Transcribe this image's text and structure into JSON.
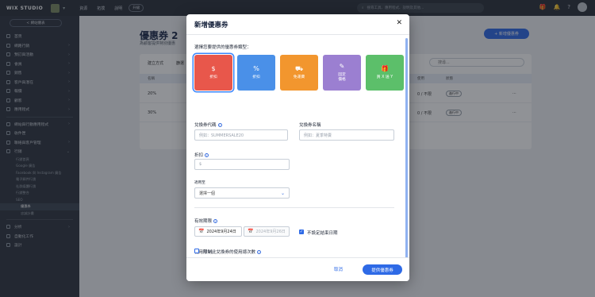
{
  "topbar": {
    "brand": "WIX STUDIO",
    "nav": [
      "資源",
      "拓撲",
      "說明"
    ],
    "pill": "升級",
    "search_placeholder": "搜尋工具、應用程式、說明及其他..."
  },
  "sidebar": {
    "back": "< 網站儀表",
    "items": [
      {
        "label": "首頁",
        "arrow": ""
      },
      {
        "label": "網路行銷",
        "arrow": "›"
      },
      {
        "label": "預訂與活動",
        "arrow": "›"
      },
      {
        "label": "會員",
        "arrow": "›"
      },
      {
        "label": "銷售",
        "arrow": "›"
      },
      {
        "label": "客戶與潛在",
        "arrow": "›"
      },
      {
        "label": "報價",
        "arrow": "›"
      },
      {
        "label": "顧客",
        "arrow": "›"
      },
      {
        "label": "應用程式",
        "arrow": "›"
      }
    ],
    "items2": [
      {
        "label": "網站與行動應用程式",
        "arrow": "›"
      },
      {
        "label": "收件匣",
        "arrow": ""
      },
      {
        "label": "聯絡與客戶管理",
        "arrow": "›"
      },
      {
        "label": "行銷",
        "arrow": "⌄"
      }
    ],
    "subs": [
      "行銷首頁",
      "Google 廣告",
      "Facebook 與 Instagram 廣告",
      "電子郵件行銷",
      "社群媒體行銷",
      "行銷整合",
      "SEO"
    ],
    "subs_l2": [
      "優惠券",
      "忠誠計畫"
    ],
    "items3": [
      {
        "label": "分析",
        "arrow": "›"
      },
      {
        "label": "自動化工作",
        "arrow": ""
      },
      {
        "label": "設計",
        "arrow": ""
      }
    ]
  },
  "main": {
    "title": "優惠券 2",
    "subtitle": "為顧客提供特別優惠",
    "new_coupon": "+ 新增優惠券",
    "filter_a": "建立方式",
    "filter_b": "篩選",
    "search": "搜尋...",
    "cols": [
      "名稱",
      "使用",
      "狀態"
    ],
    "rows": [
      {
        "name": "20%",
        "uses": "0 / 不限",
        "status": "進行中"
      },
      {
        "name": "30%",
        "uses": "0 / 不限",
        "status": "進行中"
      }
    ]
  },
  "modal": {
    "title": "新增優惠券",
    "type_prompt": "選擇您要提供的優惠券類型：",
    "types": [
      {
        "icon": "$",
        "label": "折扣",
        "color": "#e8574b",
        "selected": true
      },
      {
        "icon": "%",
        "label": "折扣",
        "color": "#4a90e8",
        "selected": false
      },
      {
        "icon": "⛟",
        "label": "免運費",
        "color": "#f2962e",
        "selected": false
      },
      {
        "icon": "✎",
        "label": "固定\n價格",
        "color": "#9b7fd1",
        "selected": false
      },
      {
        "icon": "🎁",
        "label": "買 X 送 Y",
        "color": "#5cbf6a",
        "selected": false
      }
    ],
    "code_label": "兌換券代碼",
    "code_placeholder": "例如：SUMMERSALE20",
    "name_label": "兌換券名稱",
    "name_placeholder": "例如：夏季特賣",
    "discount_label": "折扣",
    "discount_placeholder": "$",
    "apply_label": "適用至",
    "apply_value": "選擇一個",
    "validity_label": "有效期限",
    "start_date": "2024年9月24日",
    "end_date": "2024年9月26日",
    "no_end_label": "不設定結束日期",
    "limits_label": "使用限制",
    "limit_uses_label": "限制此兌換券的使用總次數",
    "cancel": "取消",
    "submit": "提供優惠券"
  }
}
